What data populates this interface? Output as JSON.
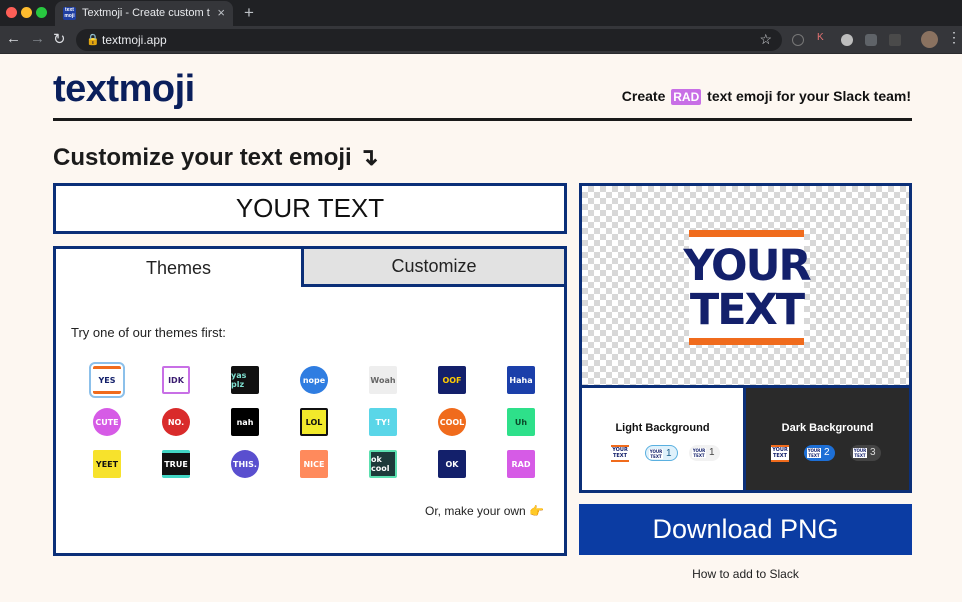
{
  "browser": {
    "tab_title": "Textmoji - Create custom text e",
    "favicon_text": "text moji",
    "url": "textmoji.app",
    "new_tab_symbol": "+",
    "close_symbol": "×"
  },
  "header": {
    "logo": "textmoji",
    "tagline_before": "Create",
    "tagline_badge": "RAD",
    "tagline_after": "text emoji for your Slack team!"
  },
  "main": {
    "heading": "Customize your text emoji ↴",
    "text_value": "YOUR TEXT",
    "tabs": [
      {
        "label": "Themes",
        "active": true
      },
      {
        "label": "Customize",
        "active": false
      }
    ],
    "try_label": "Try one of our themes first:",
    "make_own": "Or, make your own 👉",
    "themes": [
      {
        "label": "YES",
        "bg": "#ffffff",
        "fg": "#13206b",
        "bar": "#f06b1c",
        "shape": "square",
        "selected": true
      },
      {
        "label": "IDK",
        "bg": "#ffffff",
        "fg": "#3a1b70",
        "border": "#c86fe6",
        "shape": "square"
      },
      {
        "label": "yas plz",
        "bg": "#111111",
        "fg": "#7fe0d0",
        "shape": "square"
      },
      {
        "label": "nope",
        "bg": "#2f7de1",
        "fg": "#ffffff",
        "shape": "circle"
      },
      {
        "label": "Woah",
        "bg": "#eeeeee",
        "fg": "#666666",
        "shape": "square"
      },
      {
        "label": "OOF",
        "bg": "#13206b",
        "fg": "#ffcc00",
        "shape": "square"
      },
      {
        "label": "Haha",
        "bg": "#1b3faa",
        "fg": "#ffffff",
        "shape": "square"
      },
      {
        "label": "CUTE",
        "bg": "#d65be6",
        "fg": "#ffffff",
        "shape": "circle"
      },
      {
        "label": "NO.",
        "bg": "#d92b2b",
        "fg": "#ffffff",
        "shape": "circle"
      },
      {
        "label": "nah",
        "bg": "#000000",
        "fg": "#ffffff",
        "shape": "square"
      },
      {
        "label": "LOL",
        "bg": "#f2ea2b",
        "fg": "#111111",
        "border": "#111111",
        "shape": "square"
      },
      {
        "label": "TY!",
        "bg": "#5ad6e8",
        "fg": "#ffffff",
        "shape": "square"
      },
      {
        "label": "COOL",
        "bg": "#f06b1c",
        "fg": "#ffffff",
        "shape": "circle"
      },
      {
        "label": "Uh",
        "bg": "#2ee08a",
        "fg": "#0a4a2a",
        "shape": "square"
      },
      {
        "label": "YEET",
        "bg": "#f7e22c",
        "fg": "#111111",
        "shape": "square"
      },
      {
        "label": "TRUE",
        "bg": "#111111",
        "fg": "#ffffff",
        "bar": "#42d6c4",
        "shape": "square"
      },
      {
        "label": "THIS.",
        "bg": "#5a4fcf",
        "fg": "#ffffff",
        "shape": "circle"
      },
      {
        "label": "NICE",
        "bg": "#ff8a5c",
        "fg": "#ffffff",
        "shape": "square"
      },
      {
        "label": "ok cool",
        "bg": "#1d3a3a",
        "fg": "#ffffff",
        "border": "#5ce0b0",
        "shape": "square"
      },
      {
        "label": "OK",
        "bg": "#13206b",
        "fg": "#ffffff",
        "shape": "square"
      },
      {
        "label": "RAD",
        "bg": "#d65be6",
        "fg": "#ffffff",
        "shape": "square"
      }
    ]
  },
  "preview": {
    "line1": "YOUR",
    "line2": "TEXT",
    "light_title": "Light Background",
    "dark_title": "Dark Background",
    "mini_text": "YOUR TEXT",
    "light_counts": [
      "1",
      "1"
    ],
    "dark_counts": [
      "2",
      "3"
    ]
  },
  "actions": {
    "download_label": "Download PNG",
    "how_to_label": "How to add to Slack"
  },
  "colors": {
    "navy": "#0b2f78",
    "brand_orange": "#f06b1c",
    "download_blue": "#0b3ca3",
    "page_bg": "#fdf7f1"
  }
}
